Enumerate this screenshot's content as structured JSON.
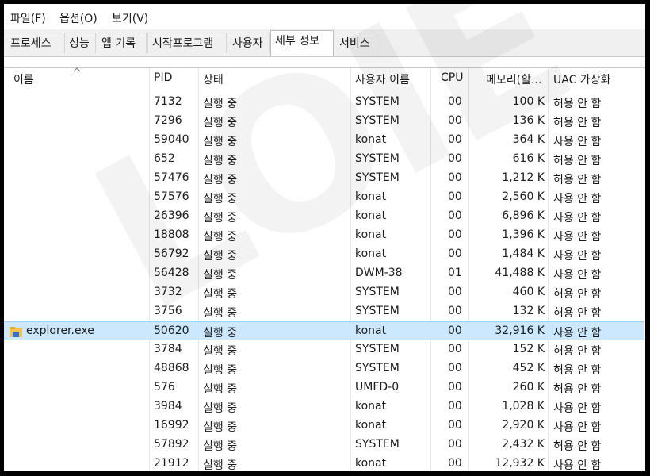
{
  "menu": [
    "파일(F)",
    "옵션(O)",
    "보기(V)"
  ],
  "tabs": [
    "프로세스",
    "성능",
    "앱 기록",
    "시작프로그램",
    "사용자",
    "세부 정보",
    "서비스"
  ],
  "active_tab": "세부 정보",
  "columns": {
    "name": "이름",
    "pid": "PID",
    "status": "상태",
    "user": "사용자 이름",
    "cpu": "CPU",
    "memory": "메모리(활...",
    "uac": "UAC 가상화"
  },
  "rows": [
    {
      "name": "",
      "pid": "7132",
      "status": "실행 중",
      "user": "SYSTEM",
      "cpu": "00",
      "memory": "100 K",
      "uac": "허용 안 함"
    },
    {
      "name": "",
      "pid": "7296",
      "status": "실행 중",
      "user": "SYSTEM",
      "cpu": "00",
      "memory": "136 K",
      "uac": "허용 안 함"
    },
    {
      "name": "",
      "pid": "59040",
      "status": "실행 중",
      "user": "konat",
      "cpu": "00",
      "memory": "364 K",
      "uac": "사용 안 함"
    },
    {
      "name": "",
      "pid": "652",
      "status": "실행 중",
      "user": "SYSTEM",
      "cpu": "00",
      "memory": "616 K",
      "uac": "허용 안 함"
    },
    {
      "name": "",
      "pid": "57476",
      "status": "실행 중",
      "user": "SYSTEM",
      "cpu": "00",
      "memory": "1,212 K",
      "uac": "허용 안 함"
    },
    {
      "name": "",
      "pid": "57576",
      "status": "실행 중",
      "user": "konat",
      "cpu": "00",
      "memory": "2,560 K",
      "uac": "사용 안 함"
    },
    {
      "name": "",
      "pid": "26396",
      "status": "실행 중",
      "user": "konat",
      "cpu": "00",
      "memory": "6,896 K",
      "uac": "사용 안 함"
    },
    {
      "name": "",
      "pid": "18808",
      "status": "실행 중",
      "user": "konat",
      "cpu": "00",
      "memory": "1,396 K",
      "uac": "사용 안 함"
    },
    {
      "name": "",
      "pid": "56792",
      "status": "실행 중",
      "user": "konat",
      "cpu": "00",
      "memory": "1,484 K",
      "uac": "사용 안 함"
    },
    {
      "name": "",
      "pid": "56428",
      "status": "실행 중",
      "user": "DWM-38",
      "cpu": "01",
      "memory": "41,488 K",
      "uac": "사용 안 함"
    },
    {
      "name": "",
      "pid": "3732",
      "status": "실행 중",
      "user": "SYSTEM",
      "cpu": "00",
      "memory": "460 K",
      "uac": "허용 안 함"
    },
    {
      "name": "",
      "pid": "3756",
      "status": "실행 중",
      "user": "SYSTEM",
      "cpu": "00",
      "memory": "132 K",
      "uac": "허용 안 함"
    },
    {
      "name": "explorer.exe",
      "pid": "50620",
      "status": "실행 중",
      "user": "konat",
      "cpu": "00",
      "memory": "32,916 K",
      "uac": "사용 안 함",
      "selected": true
    },
    {
      "name": "",
      "pid": "3784",
      "status": "실행 중",
      "user": "SYSTEM",
      "cpu": "00",
      "memory": "152 K",
      "uac": "허용 안 함"
    },
    {
      "name": "",
      "pid": "48868",
      "status": "실행 중",
      "user": "SYSTEM",
      "cpu": "00",
      "memory": "452 K",
      "uac": "허용 안 함"
    },
    {
      "name": "",
      "pid": "576",
      "status": "실행 중",
      "user": "UMFD-0",
      "cpu": "00",
      "memory": "260 K",
      "uac": "허용 안 함"
    },
    {
      "name": "",
      "pid": "3984",
      "status": "실행 중",
      "user": "konat",
      "cpu": "00",
      "memory": "1,028 K",
      "uac": "사용 안 함"
    },
    {
      "name": "",
      "pid": "16992",
      "status": "실행 중",
      "user": "konat",
      "cpu": "00",
      "memory": "2,920 K",
      "uac": "사용 안 함"
    },
    {
      "name": "",
      "pid": "57892",
      "status": "실행 중",
      "user": "SYSTEM",
      "cpu": "00",
      "memory": "2,432 K",
      "uac": "허용 안 함"
    },
    {
      "name": "",
      "pid": "21912",
      "status": "실행 중",
      "user": "konat",
      "cpu": "00",
      "memory": "12,932 K",
      "uac": "사용 안 함"
    }
  ],
  "watermark": "LOIE",
  "colors": {
    "selection": "#cce8ff",
    "selection_border": "#99d1ff",
    "folder": "#f2c14e"
  }
}
